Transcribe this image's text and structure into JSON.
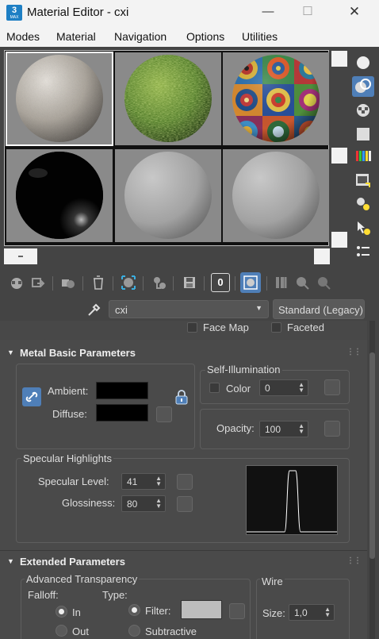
{
  "window": {
    "title": "Material Editor - cxi",
    "app_icon_text": "3",
    "app_icon_sub": "MAX"
  },
  "menu": [
    "Modes",
    "Material",
    "Navigation",
    "Options",
    "Utilities"
  ],
  "material_name": "cxi",
  "material_type": "Standard (Legacy)",
  "maps_row": {
    "face_map": "Face Map",
    "faceted": "Faceted"
  },
  "toolbar_value": "0",
  "metal_basic": {
    "title": "Metal Basic Parameters",
    "ambient": "Ambient:",
    "diffuse": "Diffuse:",
    "self_illum_title": "Self-Illumination",
    "color_label": "Color",
    "color_value": "0",
    "opacity_label": "Opacity:",
    "opacity_value": "100",
    "specular_title": "Specular Highlights",
    "spec_level_label": "Specular Level:",
    "spec_level_value": "41",
    "gloss_label": "Glossiness:",
    "gloss_value": "80"
  },
  "extended": {
    "title": "Extended Parameters",
    "adv_transp": "Advanced Transparency",
    "falloff": "Falloff:",
    "type": "Type:",
    "in": "In",
    "out": "Out",
    "filter": "Filter:",
    "subtractive": "Subtractive",
    "wire": "Wire",
    "size_label": "Size:",
    "size_value": "1,0"
  },
  "colors": {
    "accent": "#1e7fc4",
    "panel": "#4a4a4a",
    "slot_bg": "#8a8a8a"
  }
}
